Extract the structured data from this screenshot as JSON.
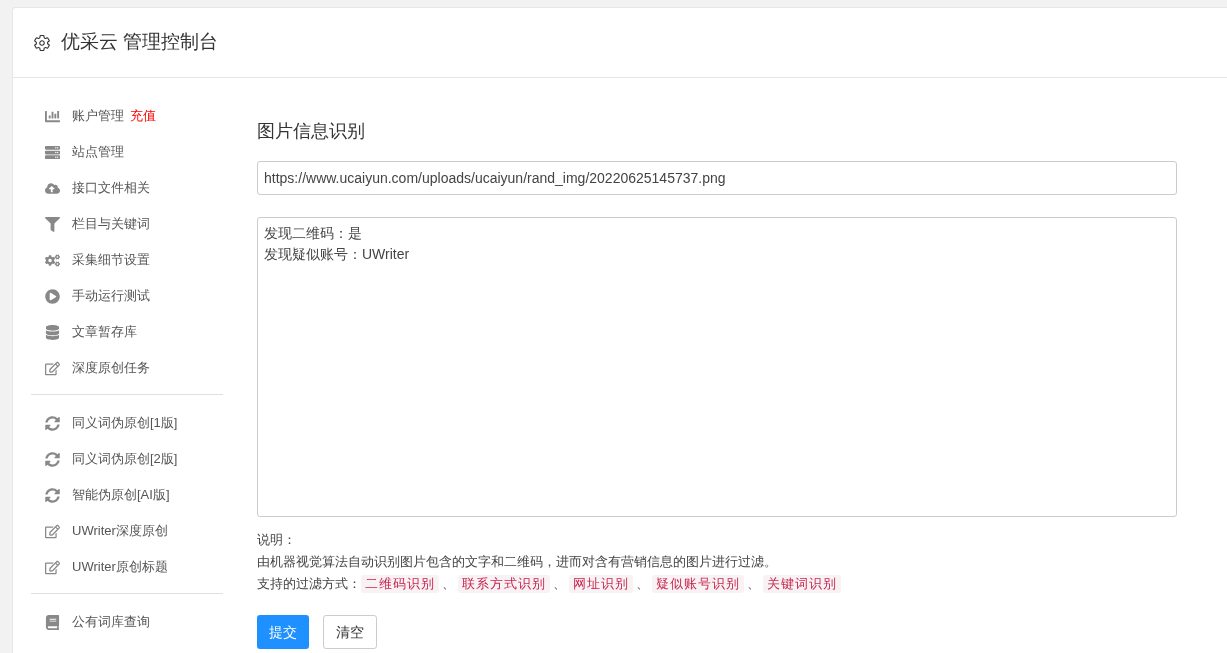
{
  "header": {
    "title": "优采云 管理控制台"
  },
  "sidebar": {
    "groups": [
      [
        {
          "kind": "chart",
          "label": "账户管理",
          "badge": "充值"
        },
        {
          "kind": "server",
          "label": "站点管理"
        },
        {
          "kind": "cloud",
          "label": "接口文件相关"
        },
        {
          "kind": "filter",
          "label": "栏目与关键词"
        },
        {
          "kind": "gears",
          "label": "采集细节设置"
        },
        {
          "kind": "play",
          "label": "手动运行测试"
        },
        {
          "kind": "database",
          "label": "文章暂存库"
        },
        {
          "kind": "edit",
          "label": "深度原创任务"
        }
      ],
      [
        {
          "kind": "refresh",
          "label": "同义词伪原创[1版]"
        },
        {
          "kind": "refresh",
          "label": "同义词伪原创[2版]"
        },
        {
          "kind": "refresh",
          "label": "智能伪原创[AI版]"
        },
        {
          "kind": "edit",
          "label": "UWriter深度原创"
        },
        {
          "kind": "edit",
          "label": "UWriter原创标题"
        }
      ],
      [
        {
          "kind": "book",
          "label": "公有词库查询"
        }
      ]
    ]
  },
  "main": {
    "title": "图片信息识别",
    "url_field": {
      "value": "https://www.ucaiyun.com/uploads/ucaiyun/rand_img/20220625145737.png"
    },
    "result_box": {
      "lines": [
        "发现二维码：是",
        "发现疑似账号：UWriter"
      ]
    },
    "notes": {
      "heading": "说明：",
      "description": "由机器视觉算法自动识别图片包含的文字和二维码，进而对含有营销信息的图片进行过滤。",
      "methods_label": "支持的过滤方式：",
      "separator": "、",
      "methods": [
        "二维码识别",
        "联系方式识别",
        "网址识别",
        "疑似账号识别",
        "关键词识别"
      ]
    },
    "buttons": [
      {
        "kind": "primary",
        "label": "提交"
      },
      {
        "kind": "default",
        "label": "清空"
      }
    ]
  }
}
